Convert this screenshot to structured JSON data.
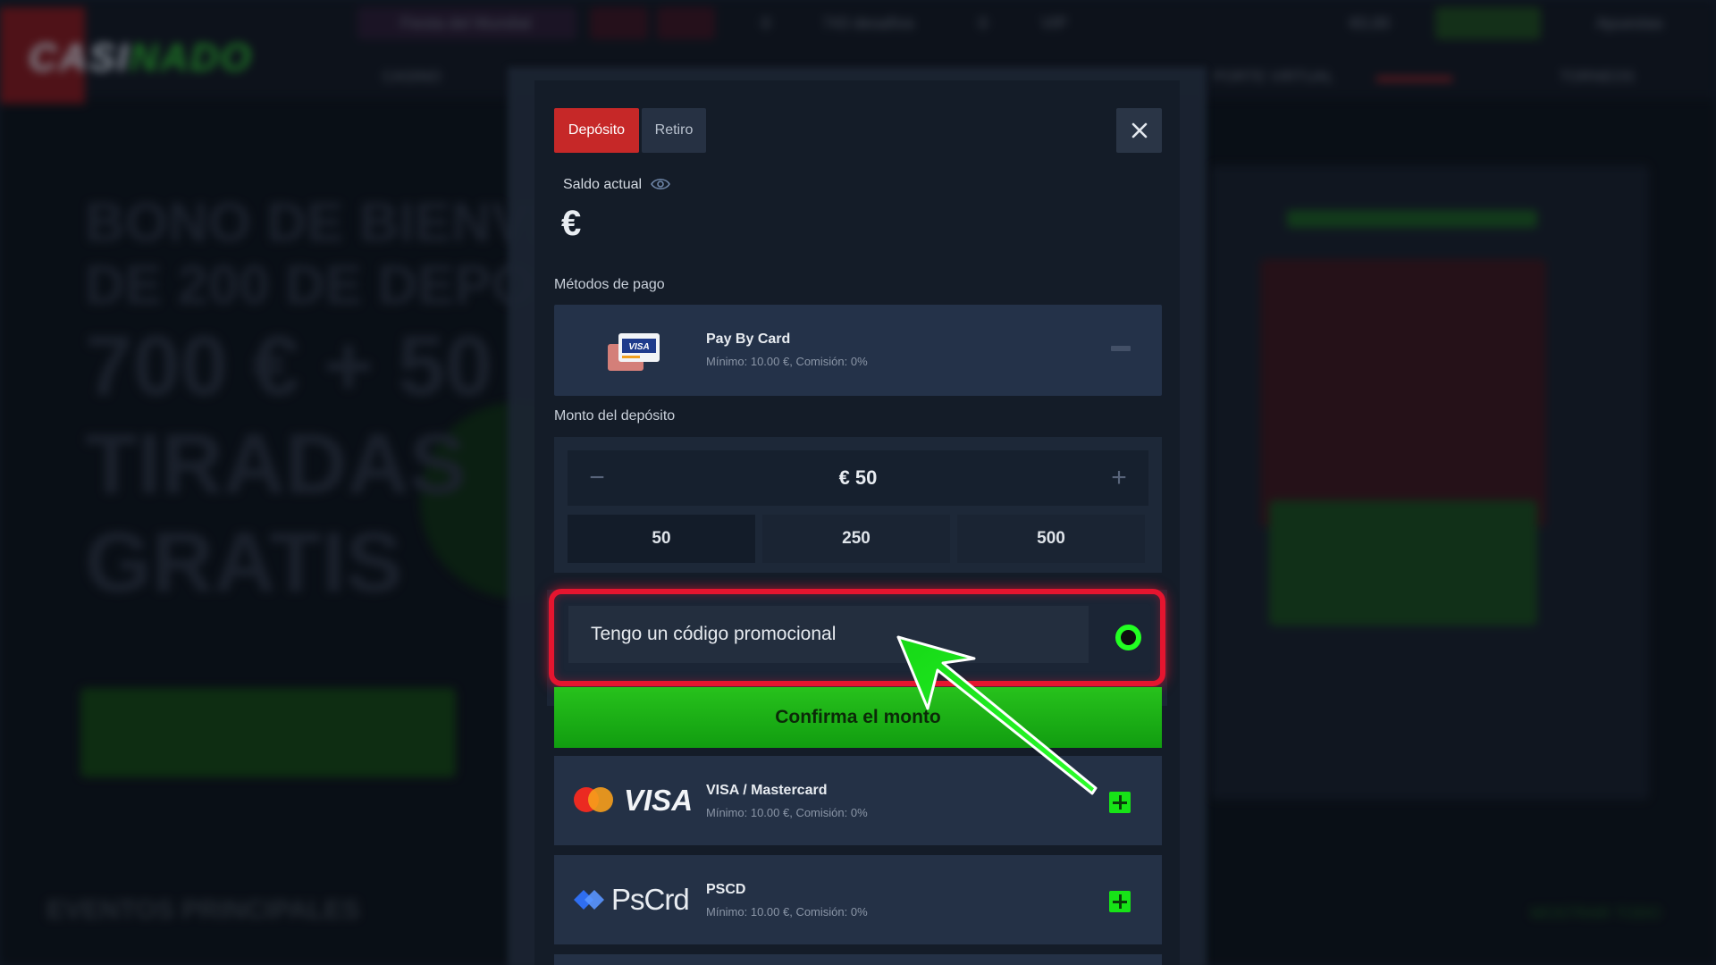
{
  "background": {
    "logo": {
      "part1": "C",
      "part2": "ASI",
      "part3": "NADO"
    },
    "top_items": [
      {
        "label": "Fiesta del Mundial"
      },
      {
        "label": "0"
      },
      {
        "label": "743 desafíos"
      },
      {
        "label": "0"
      },
      {
        "label": "VIP"
      },
      {
        "label": "€0,00"
      },
      {
        "label": "Apuestas"
      }
    ],
    "nav": [
      {
        "label": "CASINO"
      },
      {
        "label": "PORTE VIRTUAL"
      },
      {
        "label": "TORNEOS"
      }
    ],
    "hero": {
      "line1": "BONO DE BIENVE",
      "line2": "DE 200 DE DEPOS",
      "line3": "700 € + 50",
      "line4": "TIRADAS",
      "line5": "GRATIS"
    },
    "events_title": "EVENTOS PRINCIPALES",
    "more_label": "MOSTRAR TODO"
  },
  "modal": {
    "tabs": {
      "deposit": "Depósito",
      "withdraw": "Retiro"
    },
    "balance_label": "Saldo actual",
    "balance_value": "€",
    "payment_methods_label": "Métodos de pago",
    "selected_method": {
      "name": "Pay By Card",
      "details": "Mínimo: 10.00 €, Comisión: 0%"
    },
    "amount_label": "Monto del depósito",
    "amount_value": "€ 50",
    "presets": [
      "50",
      "250",
      "500"
    ],
    "promo_placeholder": "Tengo un código promocional",
    "confirm_label": "Confirma el monto",
    "other_methods": [
      {
        "logo_text": "VISA",
        "name": "VISA / Mastercard",
        "details": "Mínimo: 10.00 €, Comisión: 0%"
      },
      {
        "logo_text": "PsCrd",
        "name": "PSCD",
        "details": "Mínimo: 10.00 €, Comisión: 0%"
      }
    ]
  },
  "colors": {
    "deposit_tab": "#c62828",
    "confirm_green": "#1faf16",
    "highlight_red": "#e5152f",
    "arrow_green": "#22ff22"
  },
  "icons": [
    "close-icon",
    "eye-icon",
    "card-icon",
    "minus-icon",
    "plus-icon",
    "toggle-icon",
    "arrow-annotation"
  ]
}
